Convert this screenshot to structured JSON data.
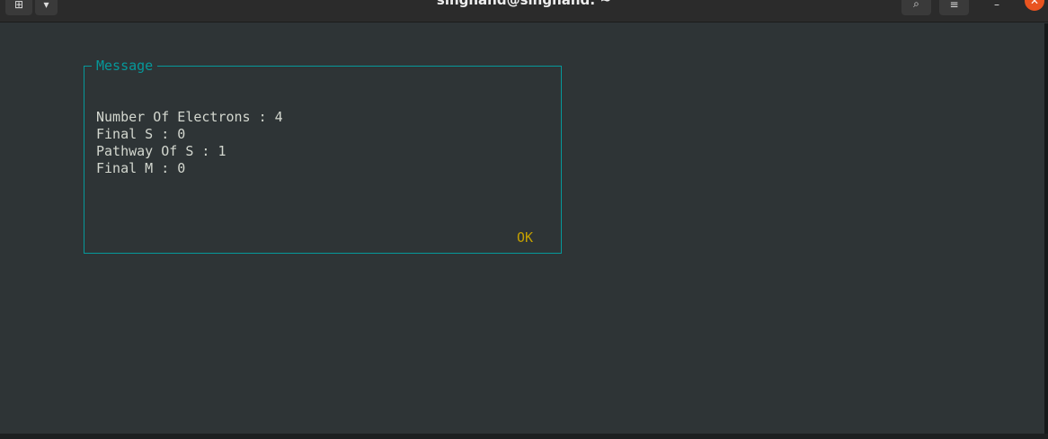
{
  "window": {
    "title": "singhand@singhand: ~",
    "new_tab_icon": "new-tab-icon",
    "menu_icon": "chevron-down-icon"
  },
  "dialog": {
    "title": "Message",
    "lines": [
      "Number Of Electrons : 4",
      "Final S : 0",
      "Pathway Of S : 1",
      "Final M : 0"
    ],
    "ok_label": "OK"
  },
  "colors": {
    "background": "#2e3436",
    "border": "#06989a",
    "text": "#d3d7cf",
    "ok": "#c4a000"
  }
}
